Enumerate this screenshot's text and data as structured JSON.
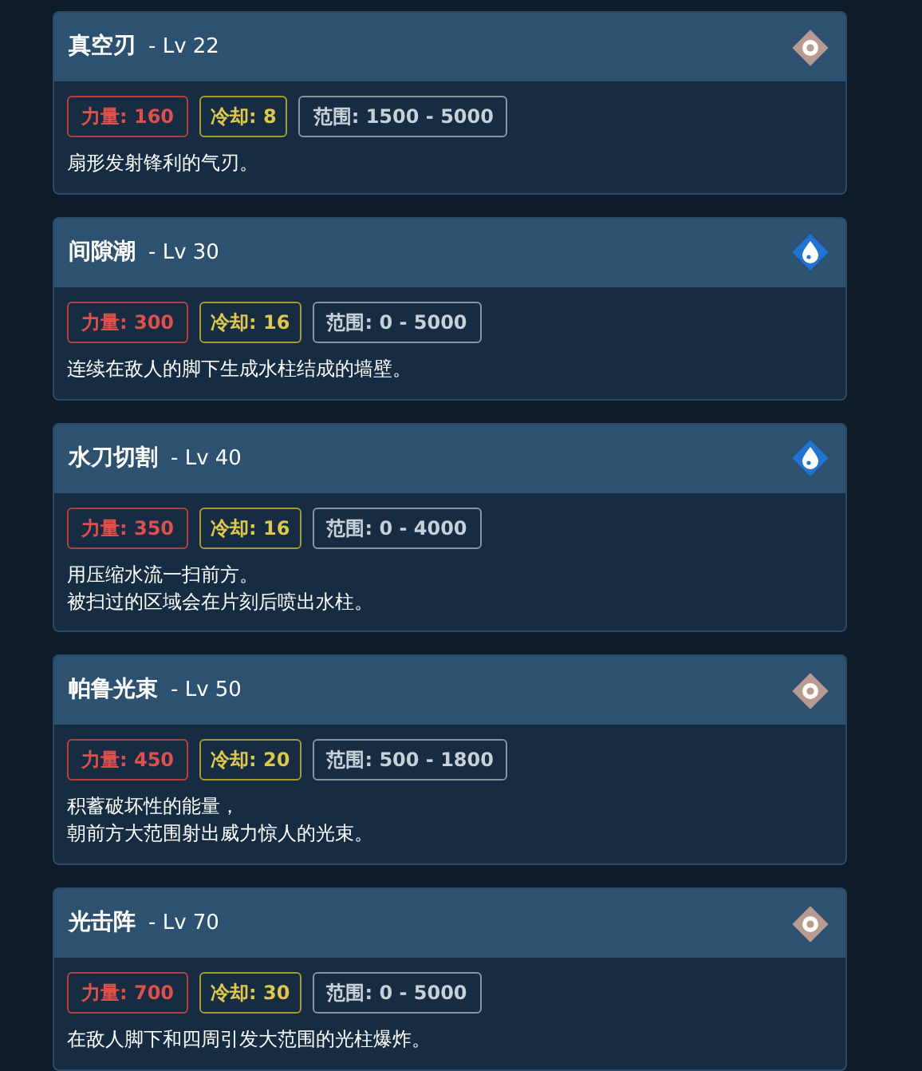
{
  "skills": [
    {
      "name": "真空刃",
      "level": "- Lv 22",
      "kind": "neutral",
      "power": "力量: 160",
      "cooldown": "冷却: 8",
      "range": "范围: 1500 - 5000",
      "description": [
        "扇形发射锋利的气刃。"
      ]
    },
    {
      "name": "间隙潮",
      "level": "- Lv 30",
      "kind": "water",
      "power": "力量: 300",
      "cooldown": "冷却: 16",
      "range": "范围: 0 - 5000",
      "description": [
        "连续在敌人的脚下生成水柱结成的墙壁。"
      ]
    },
    {
      "name": "水刀切割",
      "level": "- Lv 40",
      "kind": "water",
      "power": "力量: 350",
      "cooldown": "冷却: 16",
      "range": "范围: 0 - 4000",
      "description": [
        "用压缩水流一扫前方。",
        "被扫过的区域会在片刻后喷出水柱。"
      ]
    },
    {
      "name": "帕鲁光束",
      "level": "- Lv 50",
      "kind": "neutral",
      "power": "力量: 450",
      "cooldown": "冷却: 20",
      "range": "范围: 500 - 1800",
      "description": [
        "积蓄破坏性的能量，",
        "朝前方大范围射出威力惊人的光束。"
      ]
    },
    {
      "name": "光击阵",
      "level": "- Lv 70",
      "kind": "neutral",
      "power": "力量: 700",
      "cooldown": "冷却: 30",
      "range": "范围: 0 - 5000",
      "description": [
        "在敌人脚下和四周引发大范围的光柱爆炸。"
      ]
    }
  ]
}
